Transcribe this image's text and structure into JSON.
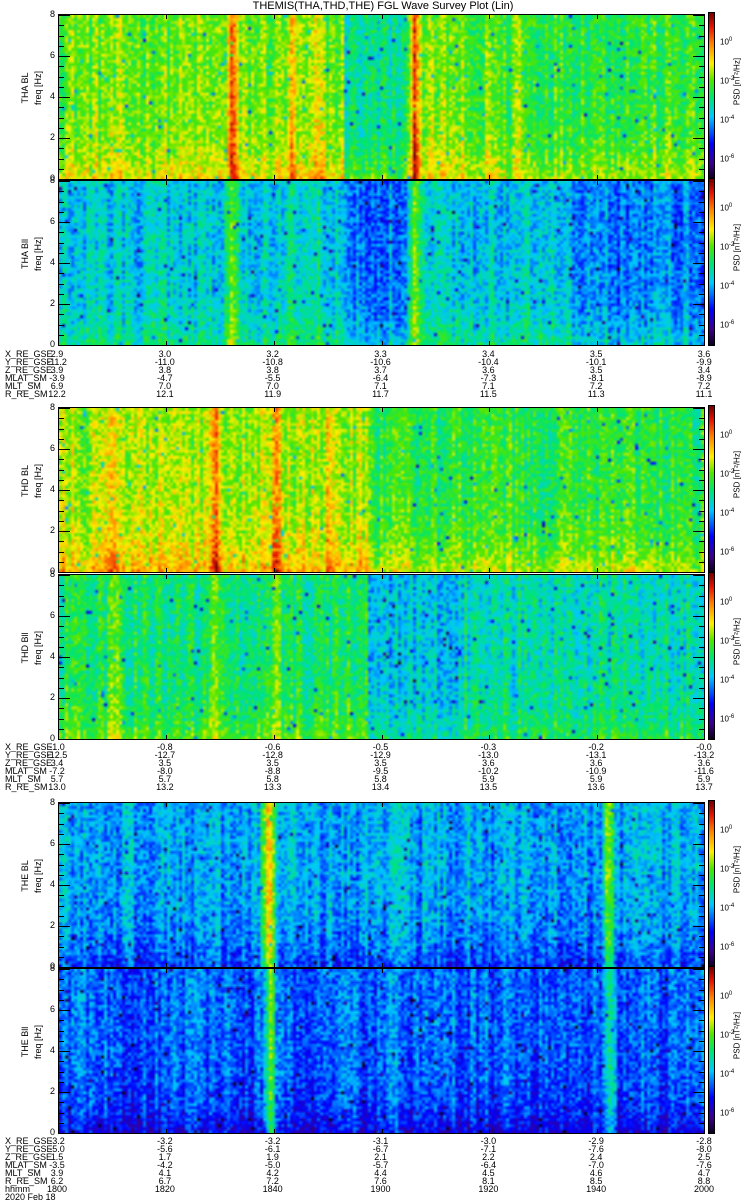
{
  "title": "THEMIS(THA,THD,THE) FGL Wave Survey Plot (Lin)",
  "chart_data": {
    "type": "heatmap",
    "title": "THEMIS(THA,THD,THE) FGL Wave Survey Plot (Lin)",
    "xlabel": "hhmm",
    "x_range_minutes": [
      0,
      120
    ],
    "ylim": [
      0,
      8
    ],
    "yticks": [
      "0",
      "2",
      "4",
      "6",
      "8"
    ],
    "ylabel": "freq [Hz]",
    "colorbar": {
      "label": "PSD [nT²/Hz]",
      "scale": "log",
      "range_exp": [
        -7,
        1.5
      ],
      "tick_exponents": [
        "0",
        "-2",
        "-4",
        "-6"
      ]
    },
    "panels": [
      {
        "name": "THA BL",
        "base": 0.6,
        "low_boost": 0.12,
        "bands_min": [
          [
            32,
            0.25
          ],
          [
            66,
            0.3
          ],
          [
            43,
            0.12
          ],
          [
            48,
            0.1
          ],
          [
            80,
            0.1
          ],
          [
            85,
            0.1
          ]
        ],
        "quiet_min": [
          [
            53,
            65,
            -0.13
          ],
          [
            75,
            120,
            -0.05
          ]
        ]
      },
      {
        "name": "THA Bll",
        "base": 0.4,
        "low_boost": 0.1,
        "bands_min": [
          [
            32,
            0.2
          ],
          [
            66,
            0.25
          ],
          [
            43,
            0.1
          ],
          [
            48,
            0.08
          ]
        ],
        "quiet_min": [
          [
            53,
            65,
            -0.08
          ],
          [
            95,
            120,
            -0.08
          ]
        ]
      },
      {
        "name": "THD BL",
        "base": 0.64,
        "low_boost": 0.14,
        "bands_min": [
          [
            10,
            0.12
          ],
          [
            29,
            0.15
          ],
          [
            40,
            0.18
          ],
          [
            50,
            0.12
          ]
        ],
        "quiet_min": [
          [
            58,
            120,
            -0.1
          ]
        ]
      },
      {
        "name": "THD Bll",
        "base": 0.5,
        "low_boost": 0.1,
        "bands_min": [
          [
            10,
            0.1
          ],
          [
            29,
            0.1
          ],
          [
            40,
            0.12
          ]
        ],
        "quiet_min": [
          [
            57,
            75,
            -0.12
          ],
          [
            75,
            120,
            -0.05
          ]
        ]
      },
      {
        "name": "THE BL",
        "base": 0.36,
        "low_boost": -0.12,
        "bands_min": [
          [
            39,
            0.35
          ],
          [
            38,
            0.2
          ],
          [
            102,
            0.28
          ],
          [
            62,
            0.08
          ]
        ],
        "quiet_min": []
      },
      {
        "name": "THE Bll",
        "base": 0.3,
        "low_boost": -0.12,
        "bands_min": [
          [
            39,
            0.3
          ],
          [
            102,
            0.22
          ],
          [
            62,
            0.06
          ]
        ],
        "quiet_min": []
      }
    ]
  },
  "ephemeris": [
    {
      "rows": [
        {
          "label": "X_RE_GSE",
          "values": [
            "2.9",
            "3.0",
            "3.2",
            "3.3",
            "3.4",
            "3.5",
            "3.6"
          ]
        },
        {
          "label": "Y_RE_GSE",
          "values": [
            "-11.2",
            "-11.0",
            "-10.8",
            "-10.6",
            "-10.4",
            "-10.1",
            "-9.9"
          ]
        },
        {
          "label": "Z_RE_GSE",
          "values": [
            "3.9",
            "3.8",
            "3.8",
            "3.7",
            "3.6",
            "3.5",
            "3.4"
          ]
        },
        {
          "label": "MLAT_SM",
          "values": [
            "-3.9",
            "-4.7",
            "-5.5",
            "-6.4",
            "-7.3",
            "-8.1",
            "-8.9"
          ]
        },
        {
          "label": "MLT_SM",
          "values": [
            "6.9",
            "7.0",
            "7.0",
            "7.1",
            "7.1",
            "7.2",
            "7.2"
          ]
        },
        {
          "label": "R_RE_SM",
          "values": [
            "12.2",
            "12.1",
            "11.9",
            "11.7",
            "11.5",
            "11.3",
            "11.1"
          ]
        }
      ]
    },
    {
      "rows": [
        {
          "label": "X_RE_GSE",
          "values": [
            "-1.0",
            "-0.8",
            "-0.6",
            "-0.5",
            "-0.3",
            "-0.2",
            "-0.0"
          ]
        },
        {
          "label": "Y_RE_GSE",
          "values": [
            "-12.5",
            "-12.7",
            "-12.8",
            "-12.9",
            "-13.0",
            "-13.1",
            "-13.2"
          ]
        },
        {
          "label": "Z_RE_GSE",
          "values": [
            "3.4",
            "3.5",
            "3.5",
            "3.5",
            "3.6",
            "3.6",
            "3.6"
          ]
        },
        {
          "label": "MLAT_SM",
          "values": [
            "-7.2",
            "-8.0",
            "-8.8",
            "-9.5",
            "-10.2",
            "-10.9",
            "-11.6"
          ]
        },
        {
          "label": "MLT_SM",
          "values": [
            "5.7",
            "5.7",
            "5.8",
            "5.8",
            "5.9",
            "5.9",
            "5.9"
          ]
        },
        {
          "label": "R_RE_SM",
          "values": [
            "13.0",
            "13.2",
            "13.3",
            "13.4",
            "13.5",
            "13.6",
            "13.7"
          ]
        }
      ]
    },
    {
      "rows": [
        {
          "label": "X_RE_GSE",
          "values": [
            "-3.2",
            "-3.2",
            "-3.2",
            "-3.1",
            "-3.0",
            "-2.9",
            "-2.8"
          ]
        },
        {
          "label": "Y_RE_GSE",
          "values": [
            "-5.0",
            "-5.6",
            "-6.1",
            "-6.7",
            "-7.1",
            "-7.6",
            "-8.0"
          ]
        },
        {
          "label": "Z_RE_GSE",
          "values": [
            "1.5",
            "1.7",
            "1.9",
            "2.1",
            "2.2",
            "2.4",
            "2.5"
          ]
        },
        {
          "label": "MLAT_SM",
          "values": [
            "-3.5",
            "-4.2",
            "-5.0",
            "-5.7",
            "-6.4",
            "-7.0",
            "-7.6"
          ]
        },
        {
          "label": "MLT_SM",
          "values": [
            "3.9",
            "4.1",
            "4.2",
            "4.4",
            "4.5",
            "4.6",
            "4.7"
          ]
        },
        {
          "label": "R_RE_SM",
          "values": [
            "6.2",
            "6.7",
            "7.2",
            "7.6",
            "8.1",
            "8.5",
            "8.8"
          ]
        },
        {
          "label": "hhmm",
          "values": [
            "1800",
            "1820",
            "1840",
            "1900",
            "1920",
            "1940",
            "2000"
          ]
        }
      ],
      "date": "2020 Feb 18"
    }
  ]
}
